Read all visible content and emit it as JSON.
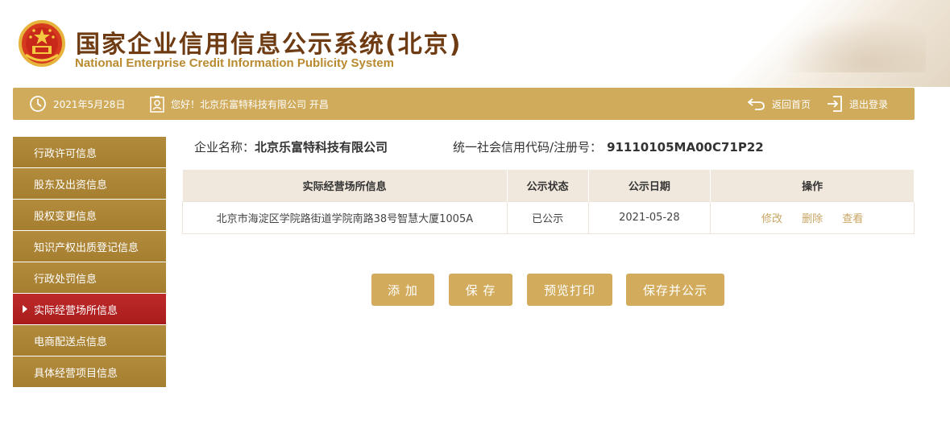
{
  "header": {
    "title_cn": "国家企业信用信息公示系统(北京)",
    "title_en": "National Enterprise Credit Information Publicity System"
  },
  "topbar": {
    "date": "2021年5月28日",
    "greeting": "您好！北京乐富特科技有限公司  开昌",
    "home_label": "返回首页",
    "logout_label": "退出登录"
  },
  "sidebar": {
    "items": [
      {
        "label": "行政许可信息",
        "active": false
      },
      {
        "label": "股东及出资信息",
        "active": false
      },
      {
        "label": "股权变更信息",
        "active": false
      },
      {
        "label": "知识产权出质登记信息",
        "active": false
      },
      {
        "label": "行政处罚信息",
        "active": false
      },
      {
        "label": "实际经营场所信息",
        "active": true
      },
      {
        "label": "电商配送点信息",
        "active": false
      },
      {
        "label": "具体经营项目信息",
        "active": false
      }
    ]
  },
  "company": {
    "name_label": "企业名称：",
    "name": "北京乐富特科技有限公司",
    "code_label": "统一社会信用代码/注册号：",
    "code": "91110105MA00C71P22"
  },
  "table": {
    "headers": [
      "实际经营场所信息",
      "公示状态",
      "公示日期",
      "操作"
    ],
    "rows": [
      {
        "address": "北京市海淀区学院路街道学院南路38号智慧大厦1005A",
        "status": "已公示",
        "date": "2021-05-28",
        "actions": [
          "修改",
          "删除",
          "查看"
        ]
      }
    ]
  },
  "buttons": {
    "add": "添 加",
    "save": "保 存",
    "preview_print": "预览打印",
    "save_publish": "保存并公示"
  },
  "colors": {
    "accent_gold": "#d0ab5c",
    "sidebar_gold": "#a57e30",
    "active_red": "#b02020",
    "title_brown": "#6e3b12"
  }
}
